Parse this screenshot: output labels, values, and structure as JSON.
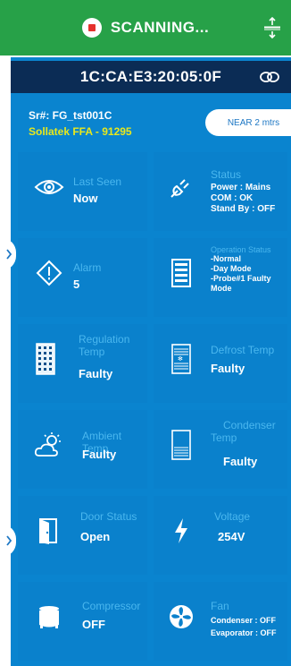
{
  "header": {
    "scan_label": "SCANNING...",
    "bg_color": "#27a148"
  },
  "device": {
    "mac": "1C:CA:E3:20:05:0F",
    "serial": "Sr#: FG_tst001C",
    "name": "Sollatek FFA - 91295",
    "proximity": "NEAR 2 mtrs"
  },
  "tiles": {
    "last_seen": {
      "label": "Last Seen",
      "value": "Now",
      "icon": "eye-icon"
    },
    "status": {
      "label": "Status",
      "lines": [
        "Power : Mains",
        "COM : OK",
        "Stand By : OFF"
      ],
      "icon": "plug-icon"
    },
    "alarm": {
      "label": "Alarm",
      "value": "5",
      "icon": "alert-diamond-icon"
    },
    "operation_status": {
      "label": "Operation Status",
      "lines": [
        "-Normal",
        "-Day Mode",
        "-Probe#1 Faulty",
        "Mode"
      ],
      "icon": "fridge-icon"
    },
    "regulation_temp": {
      "label_line1": "Regulation",
      "label_line2": "Temp",
      "value": "Faulty",
      "icon": "building-icon"
    },
    "defrost_temp": {
      "label": "Defrost Temp",
      "value": "Faulty",
      "icon": "defrost-icon"
    },
    "ambient_temp": {
      "label": "Ambient Temp",
      "value": "Faulty",
      "icon": "weather-icon"
    },
    "condenser_temp": {
      "label_line1": "Condenser",
      "label_line2": "Temp",
      "value": "Faulty",
      "icon": "condenser-icon"
    },
    "door_status": {
      "label": "Door Status",
      "value": "Open",
      "icon": "door-icon"
    },
    "voltage": {
      "label": "Voltage",
      "value": "254V",
      "icon": "lightning-icon"
    },
    "compressor": {
      "label": "Compressor",
      "value": "OFF",
      "icon": "compressor-icon"
    },
    "fan": {
      "label": "Fan",
      "lines": [
        "Condenser : OFF",
        "Evaporator : OFF"
      ],
      "icon": "fan-icon"
    }
  }
}
